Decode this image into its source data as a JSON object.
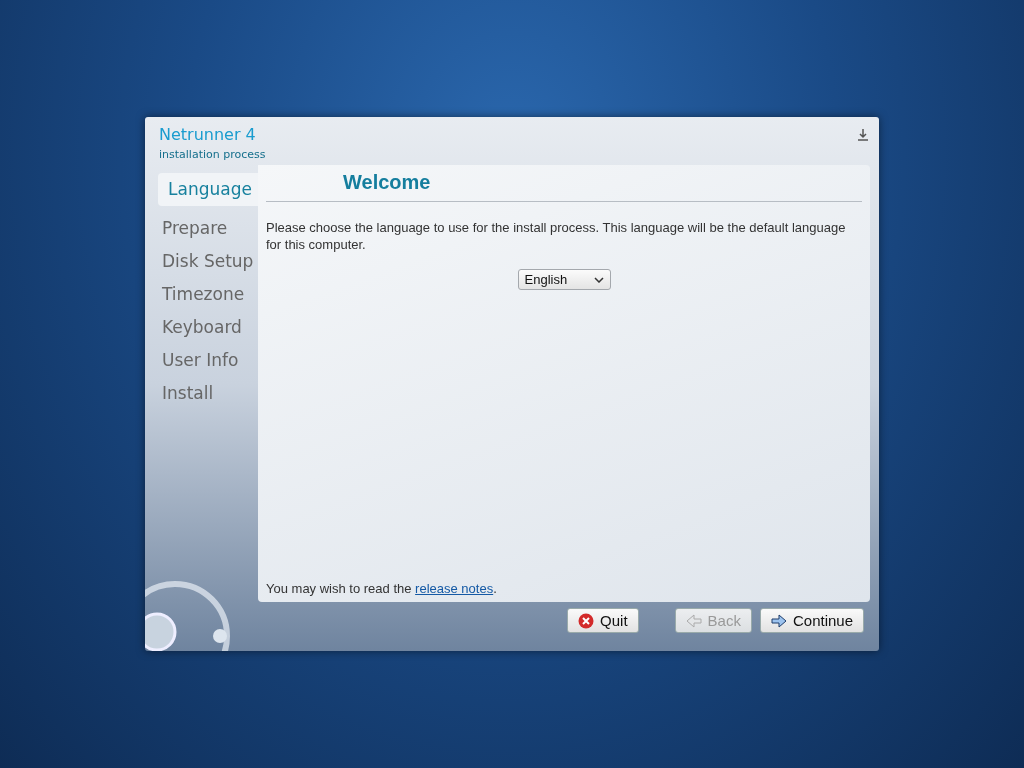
{
  "header": {
    "title": "Netrunner 4",
    "subtitle": "installation process"
  },
  "steps": [
    {
      "label": "Language",
      "selected": true
    },
    {
      "label": "Prepare",
      "selected": false
    },
    {
      "label": "Disk Setup",
      "selected": false
    },
    {
      "label": "Timezone",
      "selected": false
    },
    {
      "label": "Keyboard",
      "selected": false
    },
    {
      "label": "User Info",
      "selected": false
    },
    {
      "label": "Install",
      "selected": false
    }
  ],
  "page": {
    "title": "Welcome",
    "description": "Please choose the language to use for the install process. This language will be the default language for this computer.",
    "language_select": {
      "value": "English"
    },
    "footer_text": "You may wish to read the ",
    "footer_link": "release notes",
    "footer_end": "."
  },
  "buttons": [
    {
      "kind": "quit",
      "label": "Quit",
      "disabled": false
    },
    {
      "kind": "back",
      "label": "Back",
      "disabled": true
    },
    {
      "kind": "continue",
      "label": "Continue",
      "disabled": false
    }
  ]
}
